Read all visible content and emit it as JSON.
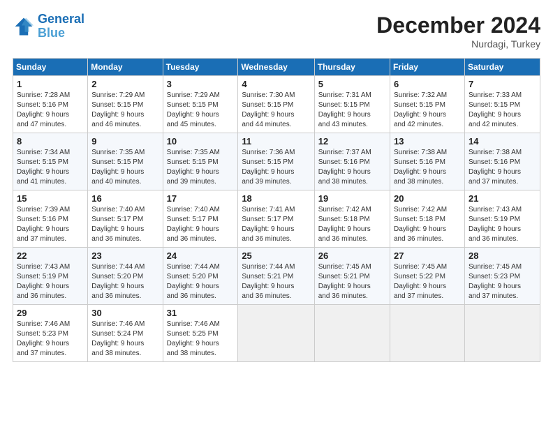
{
  "header": {
    "logo_line1": "General",
    "logo_line2": "Blue",
    "month": "December 2024",
    "location": "Nurdagi, Turkey"
  },
  "weekdays": [
    "Sunday",
    "Monday",
    "Tuesday",
    "Wednesday",
    "Thursday",
    "Friday",
    "Saturday"
  ],
  "weeks": [
    [
      {
        "day": "1",
        "info": "Sunrise: 7:28 AM\nSunset: 5:16 PM\nDaylight: 9 hours\nand 47 minutes."
      },
      {
        "day": "2",
        "info": "Sunrise: 7:29 AM\nSunset: 5:15 PM\nDaylight: 9 hours\nand 46 minutes."
      },
      {
        "day": "3",
        "info": "Sunrise: 7:29 AM\nSunset: 5:15 PM\nDaylight: 9 hours\nand 45 minutes."
      },
      {
        "day": "4",
        "info": "Sunrise: 7:30 AM\nSunset: 5:15 PM\nDaylight: 9 hours\nand 44 minutes."
      },
      {
        "day": "5",
        "info": "Sunrise: 7:31 AM\nSunset: 5:15 PM\nDaylight: 9 hours\nand 43 minutes."
      },
      {
        "day": "6",
        "info": "Sunrise: 7:32 AM\nSunset: 5:15 PM\nDaylight: 9 hours\nand 42 minutes."
      },
      {
        "day": "7",
        "info": "Sunrise: 7:33 AM\nSunset: 5:15 PM\nDaylight: 9 hours\nand 42 minutes."
      }
    ],
    [
      {
        "day": "8",
        "info": "Sunrise: 7:34 AM\nSunset: 5:15 PM\nDaylight: 9 hours\nand 41 minutes."
      },
      {
        "day": "9",
        "info": "Sunrise: 7:35 AM\nSunset: 5:15 PM\nDaylight: 9 hours\nand 40 minutes."
      },
      {
        "day": "10",
        "info": "Sunrise: 7:35 AM\nSunset: 5:15 PM\nDaylight: 9 hours\nand 39 minutes."
      },
      {
        "day": "11",
        "info": "Sunrise: 7:36 AM\nSunset: 5:15 PM\nDaylight: 9 hours\nand 39 minutes."
      },
      {
        "day": "12",
        "info": "Sunrise: 7:37 AM\nSunset: 5:16 PM\nDaylight: 9 hours\nand 38 minutes."
      },
      {
        "day": "13",
        "info": "Sunrise: 7:38 AM\nSunset: 5:16 PM\nDaylight: 9 hours\nand 38 minutes."
      },
      {
        "day": "14",
        "info": "Sunrise: 7:38 AM\nSunset: 5:16 PM\nDaylight: 9 hours\nand 37 minutes."
      }
    ],
    [
      {
        "day": "15",
        "info": "Sunrise: 7:39 AM\nSunset: 5:16 PM\nDaylight: 9 hours\nand 37 minutes."
      },
      {
        "day": "16",
        "info": "Sunrise: 7:40 AM\nSunset: 5:17 PM\nDaylight: 9 hours\nand 36 minutes."
      },
      {
        "day": "17",
        "info": "Sunrise: 7:40 AM\nSunset: 5:17 PM\nDaylight: 9 hours\nand 36 minutes."
      },
      {
        "day": "18",
        "info": "Sunrise: 7:41 AM\nSunset: 5:17 PM\nDaylight: 9 hours\nand 36 minutes."
      },
      {
        "day": "19",
        "info": "Sunrise: 7:42 AM\nSunset: 5:18 PM\nDaylight: 9 hours\nand 36 minutes."
      },
      {
        "day": "20",
        "info": "Sunrise: 7:42 AM\nSunset: 5:18 PM\nDaylight: 9 hours\nand 36 minutes."
      },
      {
        "day": "21",
        "info": "Sunrise: 7:43 AM\nSunset: 5:19 PM\nDaylight: 9 hours\nand 36 minutes."
      }
    ],
    [
      {
        "day": "22",
        "info": "Sunrise: 7:43 AM\nSunset: 5:19 PM\nDaylight: 9 hours\nand 36 minutes."
      },
      {
        "day": "23",
        "info": "Sunrise: 7:44 AM\nSunset: 5:20 PM\nDaylight: 9 hours\nand 36 minutes."
      },
      {
        "day": "24",
        "info": "Sunrise: 7:44 AM\nSunset: 5:20 PM\nDaylight: 9 hours\nand 36 minutes."
      },
      {
        "day": "25",
        "info": "Sunrise: 7:44 AM\nSunset: 5:21 PM\nDaylight: 9 hours\nand 36 minutes."
      },
      {
        "day": "26",
        "info": "Sunrise: 7:45 AM\nSunset: 5:21 PM\nDaylight: 9 hours\nand 36 minutes."
      },
      {
        "day": "27",
        "info": "Sunrise: 7:45 AM\nSunset: 5:22 PM\nDaylight: 9 hours\nand 37 minutes."
      },
      {
        "day": "28",
        "info": "Sunrise: 7:45 AM\nSunset: 5:23 PM\nDaylight: 9 hours\nand 37 minutes."
      }
    ],
    [
      {
        "day": "29",
        "info": "Sunrise: 7:46 AM\nSunset: 5:23 PM\nDaylight: 9 hours\nand 37 minutes."
      },
      {
        "day": "30",
        "info": "Sunrise: 7:46 AM\nSunset: 5:24 PM\nDaylight: 9 hours\nand 38 minutes."
      },
      {
        "day": "31",
        "info": "Sunrise: 7:46 AM\nSunset: 5:25 PM\nDaylight: 9 hours\nand 38 minutes."
      },
      {
        "day": "",
        "info": ""
      },
      {
        "day": "",
        "info": ""
      },
      {
        "day": "",
        "info": ""
      },
      {
        "day": "",
        "info": ""
      }
    ]
  ]
}
